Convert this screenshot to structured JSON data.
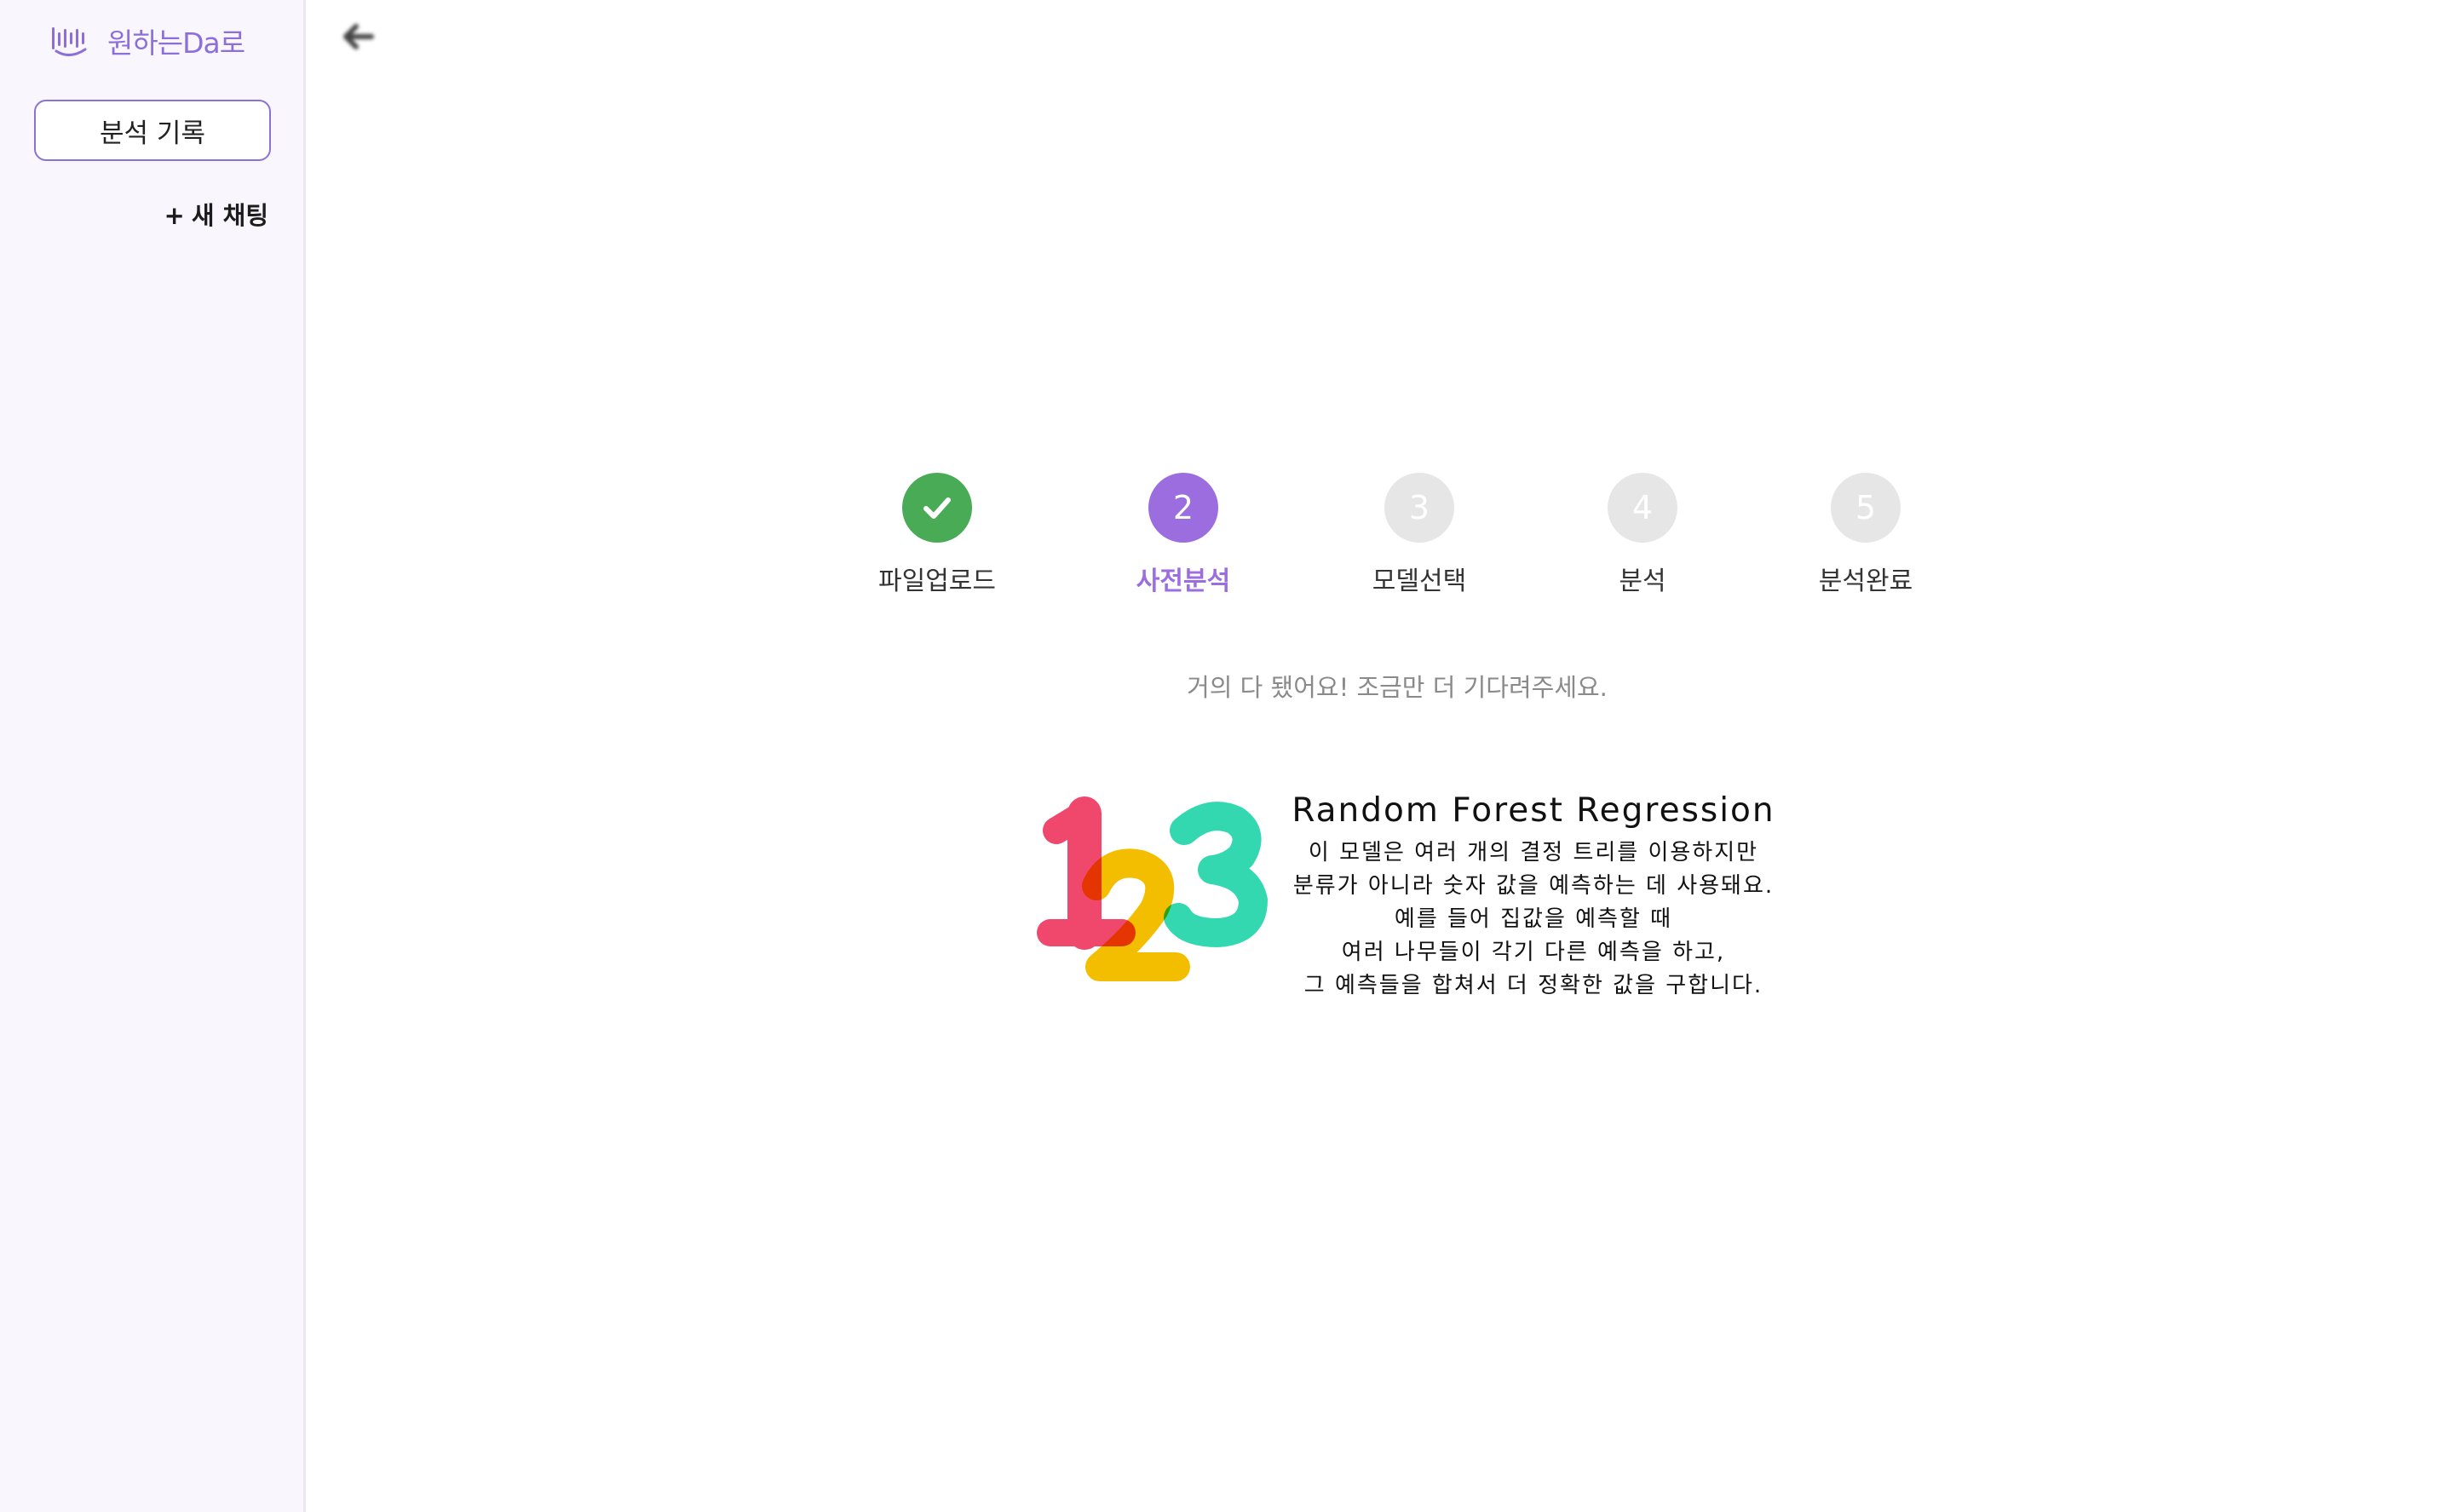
{
  "sidebar": {
    "logo_text": "원하는Da로",
    "history_button": "분석 기록",
    "new_chat_plus": "+",
    "new_chat_label": "새 채팅"
  },
  "steps": [
    {
      "number": "✔",
      "label": "파일업로드",
      "state": "done"
    },
    {
      "number": "2",
      "label": "사전분석",
      "state": "active"
    },
    {
      "number": "3",
      "label": "모델선택",
      "state": "pending"
    },
    {
      "number": "4",
      "label": "분석",
      "state": "pending"
    },
    {
      "number": "5",
      "label": "분석완료",
      "state": "pending"
    }
  ],
  "status_message": "거의 다 됐어요! 조금만 더 기다려주세요.",
  "model": {
    "title": "Random Forest Regression",
    "description": [
      "이 모델은 여러 개의 결정 트리를 이용하지만",
      "분류가 아니라 숫자 값을 예측하는 데 사용돼요.",
      "예를 들어 집값을 예측할 때",
      "여러 나무들이 각기 다른 예측을 하고,",
      "그 예측들을 합쳐서 더 정확한 값을 구합니다."
    ]
  },
  "colors": {
    "accent": "#9b6ddf",
    "done": "#49ab56",
    "pending": "#e6e6e6",
    "sidebar_bg": "#f9f6fe",
    "illus_one": "#f0476d",
    "illus_two": "#f3bd00",
    "illus_three": "#34d8b0"
  },
  "icons": {
    "logo": "waveform-logo-icon",
    "back": "arrow-left-icon",
    "done": "checkmark-icon",
    "illustration": "numbers-123-illustration"
  }
}
